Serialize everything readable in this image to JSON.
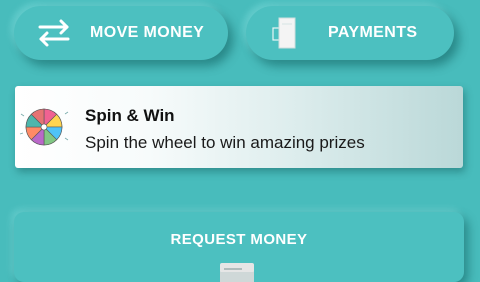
{
  "actions": {
    "move_money": {
      "label": "MOVE MONEY",
      "icon": "transfer-arrows-icon"
    },
    "payments": {
      "label": "PAYMENTS",
      "icon": "receipt-icon"
    }
  },
  "promo": {
    "title": "Spin & Win",
    "subtitle": "Spin the wheel to win amazing prizes",
    "icon": "prize-wheel-icon"
  },
  "request": {
    "label": "REQUEST MONEY",
    "icon": "wallet-icon"
  },
  "colors": {
    "background": "#48bcbc",
    "button_text": "#ffffff",
    "card_bg": "#ffffff"
  }
}
